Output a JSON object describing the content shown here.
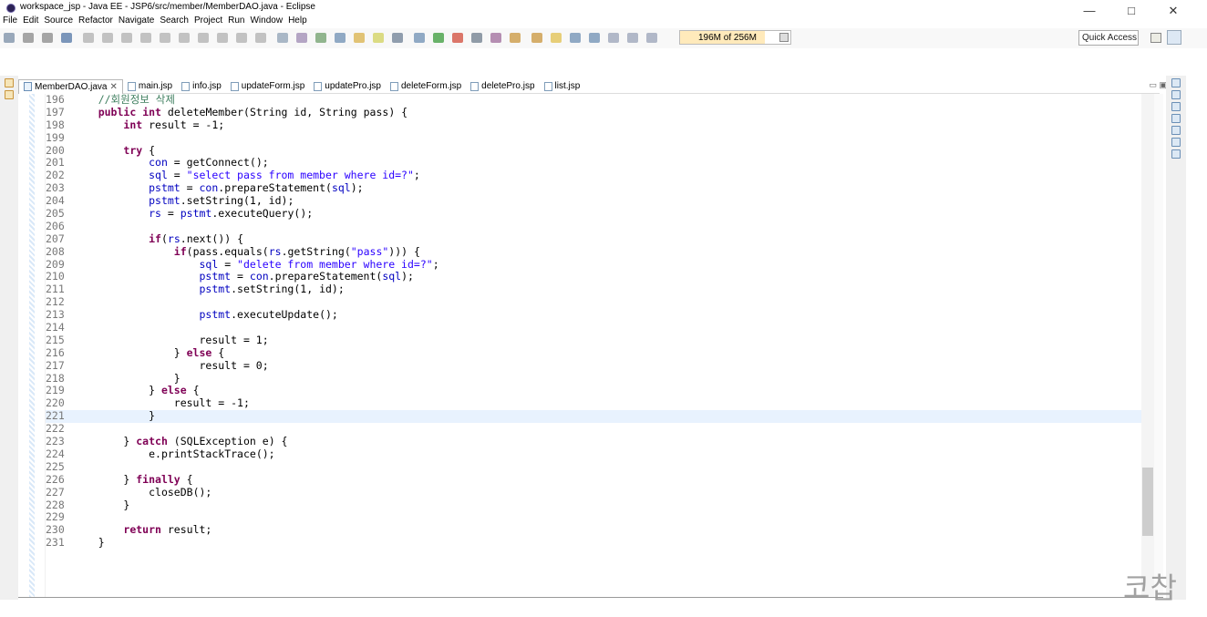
{
  "window": {
    "title": "workspace_jsp - Java EE - JSP6/src/member/MemberDAO.java - Eclipse",
    "controls": {
      "minimize": "—",
      "maximize": "□",
      "close": "✕"
    }
  },
  "menu": [
    "File",
    "Edit",
    "Source",
    "Refactor",
    "Navigate",
    "Search",
    "Project",
    "Run",
    "Window",
    "Help"
  ],
  "toolbar": {
    "heap_status": "196M of 256M",
    "heap_used_fraction": 0.77,
    "quick_access": "Quick Access"
  },
  "tabs": [
    {
      "label": "MemberDAO.java",
      "close": "✕",
      "active": true
    },
    {
      "label": "main.jsp"
    },
    {
      "label": "info.jsp"
    },
    {
      "label": "updateForm.jsp"
    },
    {
      "label": "updatePro.jsp"
    },
    {
      "label": "deleteForm.jsp"
    },
    {
      "label": "deletePro.jsp"
    },
    {
      "label": "list.jsp"
    }
  ],
  "editor": {
    "current_line": "221",
    "lines": [
      {
        "no": "196",
        "text": "    //회원정보 삭제"
      },
      {
        "no": "197",
        "text": "    public int deleteMember(String id, String pass) {"
      },
      {
        "no": "198",
        "text": "        int result = -1;"
      },
      {
        "no": "199",
        "text": ""
      },
      {
        "no": "200",
        "text": "        try {"
      },
      {
        "no": "201",
        "text": "            con = getConnect();"
      },
      {
        "no": "202",
        "text": "            sql = \"select pass from member where id=?\";"
      },
      {
        "no": "203",
        "text": "            pstmt = con.prepareStatement(sql);"
      },
      {
        "no": "204",
        "text": "            pstmt.setString(1, id);"
      },
      {
        "no": "205",
        "text": "            rs = pstmt.executeQuery();"
      },
      {
        "no": "206",
        "text": ""
      },
      {
        "no": "207",
        "text": "            if(rs.next()) {"
      },
      {
        "no": "208",
        "text": "                if(pass.equals(rs.getString(\"pass\"))) {"
      },
      {
        "no": "209",
        "text": "                    sql = \"delete from member where id=?\";"
      },
      {
        "no": "210",
        "text": "                    pstmt = con.prepareStatement(sql);"
      },
      {
        "no": "211",
        "text": "                    pstmt.setString(1, id);"
      },
      {
        "no": "212",
        "text": ""
      },
      {
        "no": "213",
        "text": "                    pstmt.executeUpdate();"
      },
      {
        "no": "214",
        "text": ""
      },
      {
        "no": "215",
        "text": "                    result = 1;"
      },
      {
        "no": "216",
        "text": "                } else {"
      },
      {
        "no": "217",
        "text": "                    result = 0;"
      },
      {
        "no": "218",
        "text": "                }"
      },
      {
        "no": "219",
        "text": "            } else {"
      },
      {
        "no": "220",
        "text": "                result = -1;"
      },
      {
        "no": "221",
        "text": "            }"
      },
      {
        "no": "222",
        "text": ""
      },
      {
        "no": "223",
        "text": "        } catch (SQLException e) {"
      },
      {
        "no": "224",
        "text": "            e.printStackTrace();"
      },
      {
        "no": "225",
        "text": ""
      },
      {
        "no": "226",
        "text": "        } finally {"
      },
      {
        "no": "227",
        "text": "            closeDB();"
      },
      {
        "no": "228",
        "text": "        }"
      },
      {
        "no": "229",
        "text": ""
      },
      {
        "no": "230",
        "text": "        return result;"
      },
      {
        "no": "231",
        "text": "    }"
      }
    ]
  },
  "watermark": "코찹",
  "colors": {
    "keyword": "#7f0055",
    "string": "#2a00ff",
    "comment": "#3f7f5f",
    "field": "#0000c0",
    "current_line_bg": "#e8f2fe"
  }
}
